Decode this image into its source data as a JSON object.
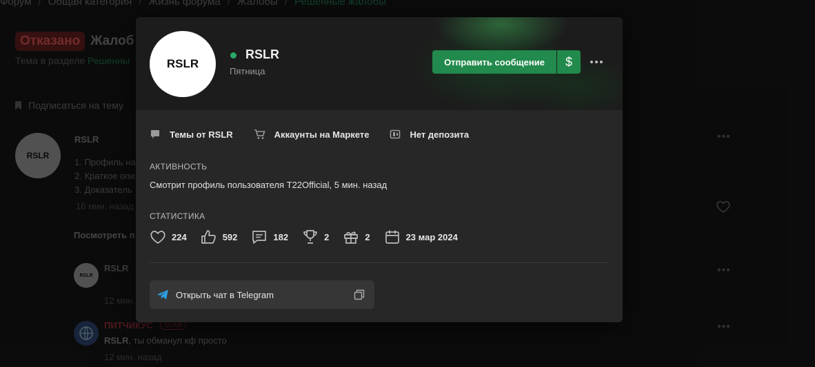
{
  "background": {
    "breadcrumb": [
      "Форум",
      "Общая категория",
      "Жизнь форума",
      "Жалобы",
      "Решенные жалобы"
    ],
    "thread": {
      "status": "Отказано",
      "title": "Жалоб",
      "subtitle_prefix": "Тема в разделе",
      "subtitle_link": "Решенны"
    },
    "subscribe_label": "Подписаться на тему",
    "post": {
      "avatar_text": "RSLR",
      "author": "RSLR",
      "lines": [
        "1. Профиль на",
        "2. Краткое опи",
        "3. Доказатель"
      ],
      "time": "16 мин. назад"
    },
    "view_more": "Посмотреть п",
    "comment1": {
      "avatar_text": "RSLR",
      "author": "RSLR",
      "time": "12 мин."
    },
    "comment2": {
      "author": "ПИТЧИКУС",
      "tag": "SCAM",
      "mention": "RSLR",
      "text": ", ты обманул кф просто",
      "time": "12 мин. назад"
    }
  },
  "card": {
    "avatar_text": "RSLR",
    "username": "RSLR",
    "subtitle": "Пятница",
    "send_message_label": "Отправить сообщение",
    "dollar_label": "$",
    "links": [
      {
        "icon": "chat-bubble-icon",
        "label": "Темы от RSLR"
      },
      {
        "icon": "cart-icon",
        "label": "Аккаунты на Маркете"
      },
      {
        "icon": "wallet-icon",
        "label": "Нет депозита"
      }
    ],
    "activity_title": "АКТИВНОСТЬ",
    "activity_text": "Смотрит профиль пользователя T22Official, 5 мин. назад",
    "stats_title": "СТАТИСТИКА",
    "stats": [
      {
        "icon": "heart-icon",
        "value": "224"
      },
      {
        "icon": "thumbs-up-icon",
        "value": "592"
      },
      {
        "icon": "message-icon",
        "value": "182"
      },
      {
        "icon": "trophy-icon",
        "value": "2"
      },
      {
        "icon": "gift-icon",
        "value": "2"
      },
      {
        "icon": "calendar-icon",
        "value": "23 мар 2024"
      }
    ],
    "telegram_label": "Открыть чат в Telegram"
  },
  "colors": {
    "accent_green": "#228a4c",
    "online": "#2aa866",
    "card_bg": "#272727",
    "telegram_blue": "#2f9ee0"
  }
}
